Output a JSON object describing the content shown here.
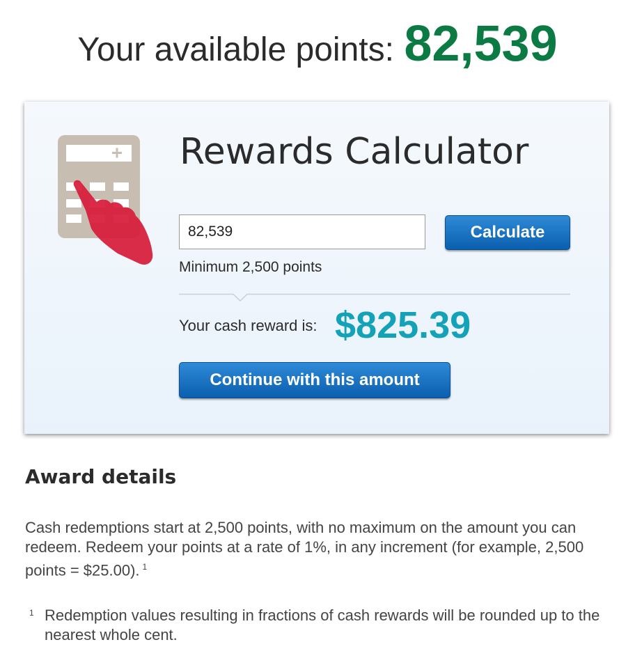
{
  "header": {
    "label": "Your available points:",
    "points": "82,539"
  },
  "calculator": {
    "title": "Rewards Calculator",
    "input_value": "82,539",
    "calculate_label": "Calculate",
    "minimum_note": "Minimum 2,500 points",
    "reward_label": "Your cash reward is:",
    "reward_value": "$825.39",
    "continue_label": "Continue with this amount",
    "icon": "calculator-hand-icon"
  },
  "award_details": {
    "heading": "Award details",
    "body": "Cash redemptions start at 2,500 points, with no maximum on the amount you can redeem. Redeem your points at a rate of 1%, in any increment (for example, 2,500 points = $25.00).",
    "body_footnote_ref": "1",
    "footnote_mark": "1",
    "footnote_text": "Redemption values resulting in fractions of cash rewards will be rounded up to the nearest whole cent."
  },
  "colors": {
    "points_green": "#0b7a43",
    "reward_teal": "#13a2b8",
    "button_blue": "#0a5fae",
    "hand_red": "#d71a3a",
    "calculator_tan": "#c7bdb0"
  }
}
